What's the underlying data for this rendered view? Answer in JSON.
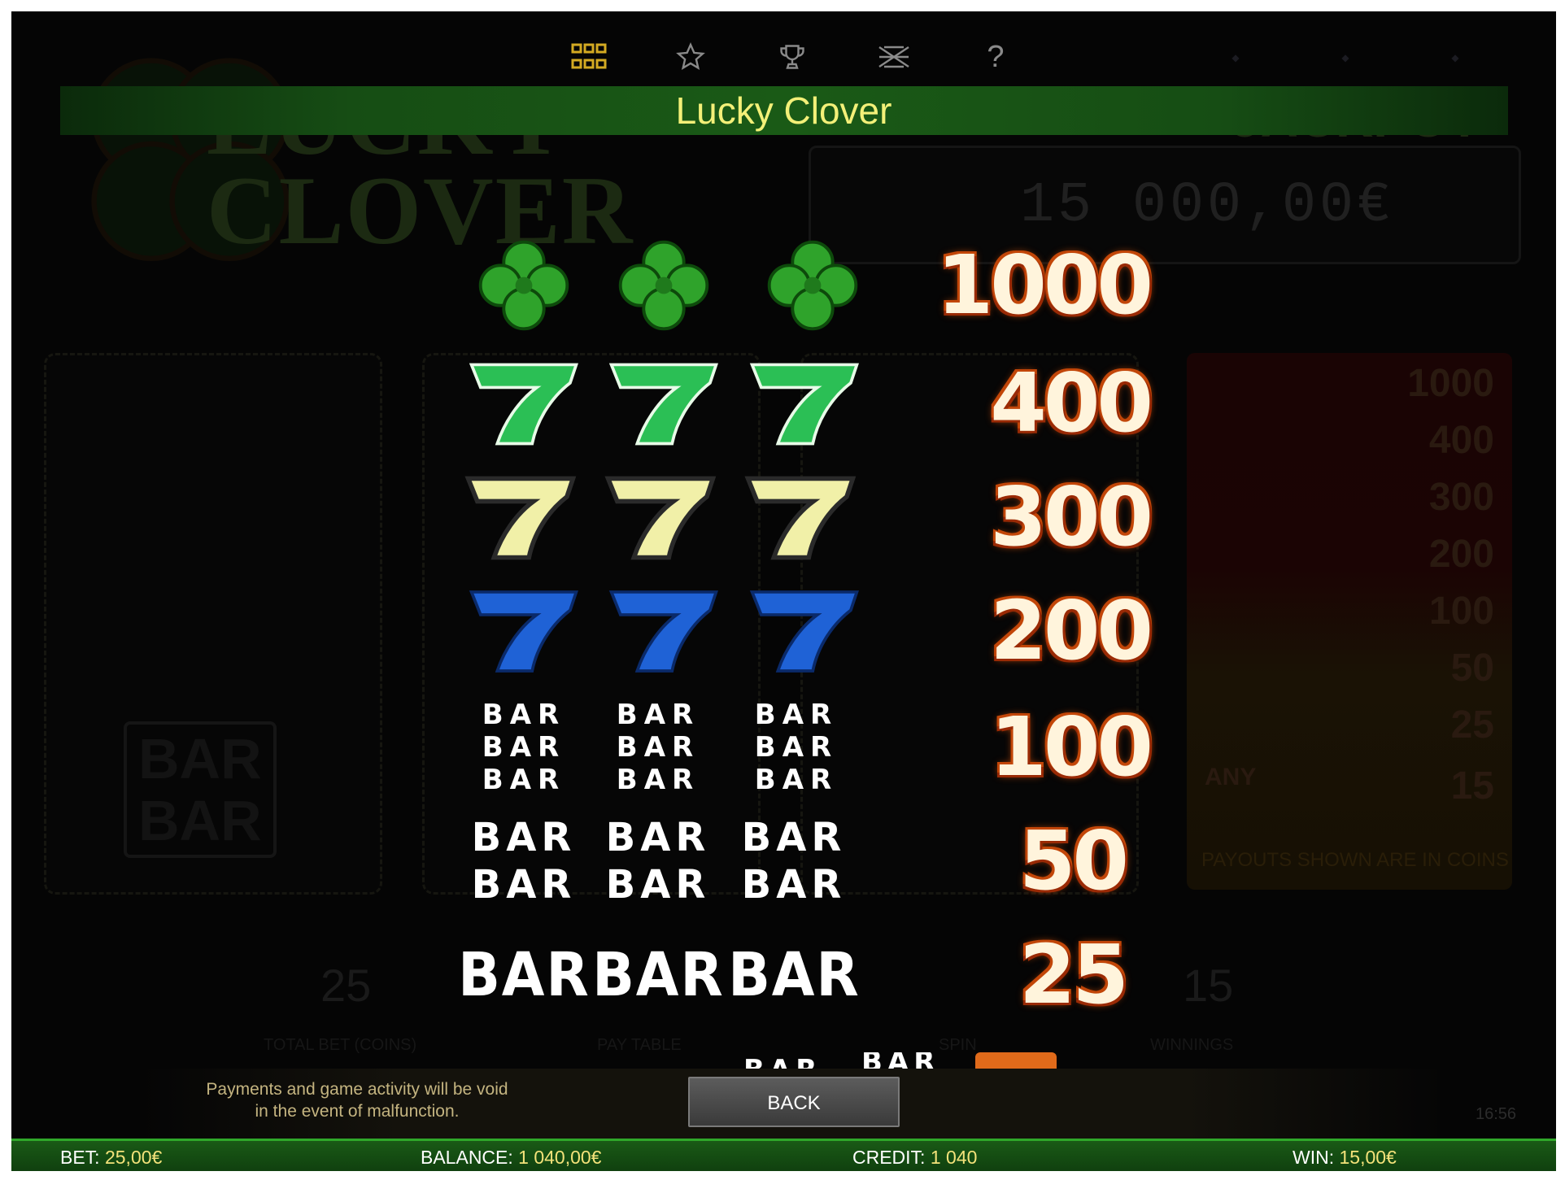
{
  "colors": {
    "title_text": "#f3f078",
    "title_bar_green": "#1a5a16",
    "payout_glow": "#d8520a",
    "status_value": "#f3e27a",
    "background": "#050505"
  },
  "background_game": {
    "logo_line1": "LUCKY",
    "logo_line2": "CLOVER",
    "jackpot_label": "JACKPOT",
    "jackpot_value": "15 000,00€",
    "total_bet_value": "25",
    "total_bet_label": "TOTAL BET (COINS)",
    "pay_table_label": "PAY TABLE",
    "spin_label": "SPIN",
    "winnings_value": "15",
    "winnings_label": "WINNINGS",
    "paytable_values": [
      "1000",
      "400",
      "300",
      "200",
      "100",
      "50",
      "25",
      "15"
    ],
    "paytable_any": "ANY",
    "paytable_note": "PAYOUTS SHOWN ARE IN COINS",
    "time": "16:56"
  },
  "toolbar": {
    "icons": [
      "grid-icon",
      "star-icon",
      "trophy-icon",
      "pattern-icon",
      "help-icon"
    ],
    "help_symbol": "?"
  },
  "title": "Lucky Clover",
  "symbols": {
    "bar": "BAR"
  },
  "paytable": [
    {
      "symbol": "clover",
      "payout": "1000"
    },
    {
      "symbol": "green-seven",
      "payout": "400"
    },
    {
      "symbol": "yellow-seven",
      "payout": "300"
    },
    {
      "symbol": "blue-seven",
      "payout": "200"
    },
    {
      "symbol": "triple-bar",
      "payout": "100"
    },
    {
      "symbol": "double-bar",
      "payout": "50"
    },
    {
      "symbol": "single-bar",
      "payout": "25"
    }
  ],
  "footer": {
    "disclaimer_line1": "Payments and game activity will be void",
    "disclaimer_line2": "in the event of malfunction.",
    "back_label": "BACK"
  },
  "status_bar": {
    "bet_label": "BET:",
    "bet_value": "25,00€",
    "balance_label": "BALANCE:",
    "balance_value": "1 040,00€",
    "credit_label": "CREDIT:",
    "credit_value": "1 040",
    "win_label": "WIN:",
    "win_value": "15,00€"
  }
}
